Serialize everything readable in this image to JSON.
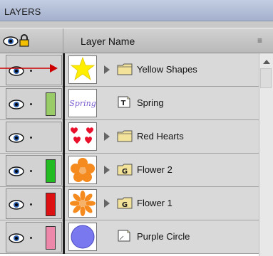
{
  "panel": {
    "title": "LAYERS",
    "header": {
      "column_label": "Layer Name",
      "visibility_icon": "eye-icon",
      "lock_icon": "padlock-icon",
      "menu_icon": "panel-menu-icon"
    }
  },
  "layers": [
    {
      "name": "Yellow Shapes",
      "type": "folder",
      "expandable": true,
      "color": "",
      "thumbnail": "yellow-star"
    },
    {
      "name": "Spring",
      "type": "text",
      "expandable": false,
      "color": "#99cc66",
      "thumbnail": "spring-text"
    },
    {
      "name": "Red Hearts",
      "type": "folder",
      "expandable": true,
      "color": "",
      "thumbnail": "red-hearts"
    },
    {
      "name": "Flower 2",
      "type": "group",
      "expandable": true,
      "color": "#22bb22",
      "thumbnail": "orange-flower"
    },
    {
      "name": "Flower 1",
      "type": "group",
      "expandable": true,
      "color": "#dd1111",
      "thumbnail": "orange-flower-small"
    },
    {
      "name": "Purple Circle",
      "type": "shape",
      "expandable": false,
      "color": "#ee88aa",
      "thumbnail": "purple-circle"
    }
  ],
  "icons": {
    "folder": "folder-icon",
    "text": "text-layer-icon",
    "group": "group-icon",
    "shape": "shape-layer-icon",
    "expander": "expand-triangle-icon"
  },
  "thumbnail_text": {
    "spring": "Spring"
  },
  "glyphs": {
    "group_letter": "G",
    "text_letter": "T",
    "menu": "≡"
  },
  "annotation": {
    "color": "#cc0000"
  },
  "scrollbar": {
    "up_arrow": "scroll-up-arrow"
  }
}
